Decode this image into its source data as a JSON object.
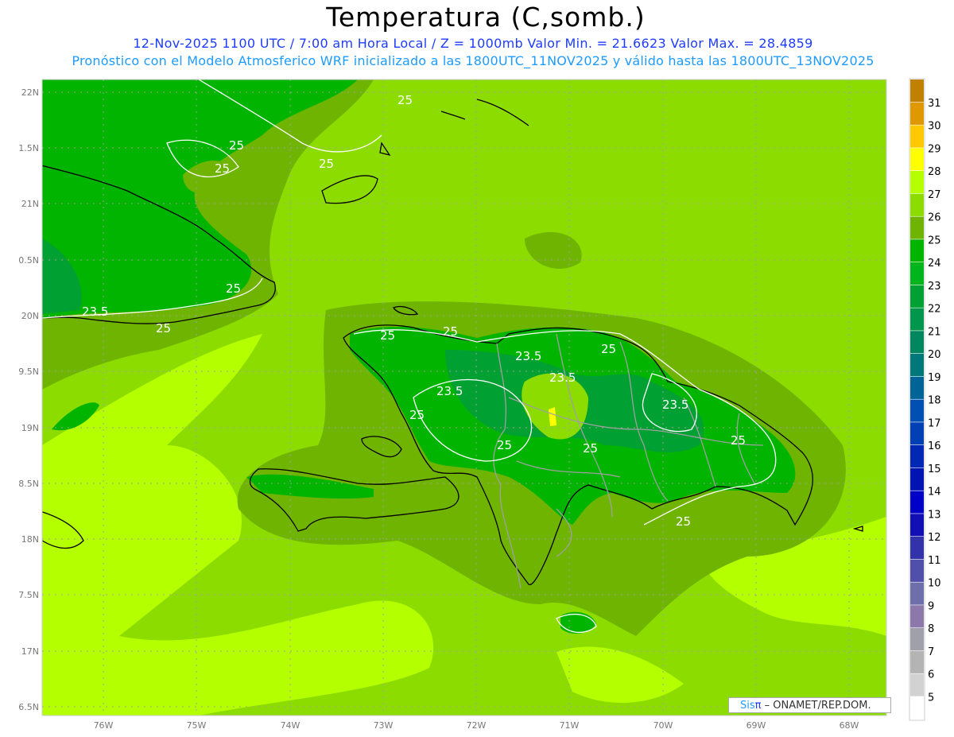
{
  "header": {
    "title": "Temperatura (C,somb.)",
    "subtitle": "12-Nov-2025  1100 UTC / 7:00 am Hora Local / Z = 1000mb   Valor Min. = 21.6623  Valor Max. = 28.4859",
    "model_line": "Pronóstico con el Modelo Atmosferico WRF inicializado a las 1800UTC_11NOV2025 y válido hasta las  1800UTC_13NOV2025"
  },
  "map": {
    "lat_labels": [
      "22N",
      "1.5N",
      "21N",
      "0.5N",
      "20N",
      "9.5N",
      "19N",
      "8.5N",
      "18N",
      "7.5N",
      "17N",
      "6.5N"
    ],
    "lon_labels": [
      "76W",
      "75W",
      "74W",
      "73W",
      "72W",
      "71W",
      "70W",
      "69W",
      "68W"
    ],
    "contour_labels": [
      "25",
      "25",
      "25",
      "25",
      "25",
      "23.5",
      "25",
      "25",
      "25",
      "23.5",
      "23.5",
      "25",
      "23.5",
      "23.5",
      "25",
      "25",
      "25",
      "25",
      "25"
    ],
    "colors": {
      "ocean": "#8cdc00",
      "warm": "#b4ff00",
      "mid": "#6eb400",
      "cool": "#00b400",
      "cooler": "#00a032",
      "coastline": "#000000",
      "borders": "#a0a0a0",
      "contour": "#ffffff"
    }
  },
  "colorbar": {
    "labels": [
      "31",
      "30",
      "29",
      "28",
      "27",
      "26",
      "25",
      "24",
      "23",
      "22",
      "21",
      "20",
      "19",
      "18",
      "17",
      "16",
      "15",
      "14",
      "13",
      "12",
      "11",
      "10",
      "9",
      "8",
      "7",
      "6",
      "5"
    ],
    "colors": [
      "#c08000",
      "#e09800",
      "#ffc800",
      "#ffff00",
      "#b4ff00",
      "#8cdc00",
      "#6eb400",
      "#00b400",
      "#00b41e",
      "#00a032",
      "#00964b",
      "#00875f",
      "#00787a",
      "#006496",
      "#0050b4",
      "#0040b4",
      "#0028b4",
      "#0014b4",
      "#0000c8",
      "#1010b4",
      "#3232aa",
      "#5050aa",
      "#6e6eaa",
      "#8c78aa",
      "#a0a0aa",
      "#b4b4b4",
      "#d2d2d2",
      "#ffffff"
    ]
  },
  "credit": {
    "brand_a": "Sis",
    "brand_b": "π",
    "text": "– ONAMET/REP.DOM."
  }
}
